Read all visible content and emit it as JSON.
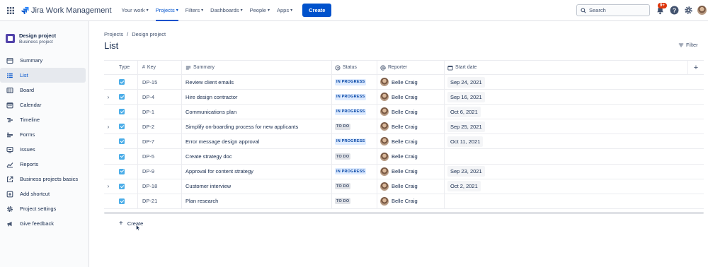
{
  "app": {
    "name": "Jira Work Management",
    "nav": [
      {
        "label": "Your work",
        "active": false
      },
      {
        "label": "Projects",
        "active": true
      },
      {
        "label": "Filters",
        "active": false
      },
      {
        "label": "Dashboards",
        "active": false
      },
      {
        "label": "People",
        "active": false
      },
      {
        "label": "Apps",
        "active": false
      }
    ],
    "create_label": "Create",
    "search_placeholder": "Search",
    "notification_badge": "9+",
    "accent": "#0052cc"
  },
  "sidebar": {
    "project_name": "Design project",
    "project_type": "Business project",
    "items": [
      {
        "label": "Summary",
        "icon": "summary-icon",
        "active": false
      },
      {
        "label": "List",
        "icon": "list-icon",
        "active": true
      },
      {
        "label": "Board",
        "icon": "board-icon",
        "active": false
      },
      {
        "label": "Calendar",
        "icon": "calendar-icon",
        "active": false
      },
      {
        "label": "Timeline",
        "icon": "timeline-icon",
        "active": false
      },
      {
        "label": "Forms",
        "icon": "forms-icon",
        "active": false
      },
      {
        "label": "Issues",
        "icon": "issues-icon",
        "active": false
      },
      {
        "label": "Reports",
        "icon": "reports-icon",
        "active": false
      },
      {
        "label": "Business projects basics",
        "icon": "external-link-icon",
        "active": false
      },
      {
        "label": "Add shortcut",
        "icon": "add-shortcut-icon",
        "active": false
      },
      {
        "label": "Project settings",
        "icon": "gear-icon",
        "active": false
      },
      {
        "label": "Give feedback",
        "icon": "megaphone-icon",
        "active": false
      }
    ]
  },
  "main": {
    "breadcrumb": [
      "Projects",
      "Design project"
    ],
    "title": "List",
    "filter_label": "Filter",
    "columns": {
      "type": "Type",
      "key": "Key",
      "summary": "Summary",
      "status": "Status",
      "reporter": "Reporter",
      "start_date": "Start date"
    },
    "rows": [
      {
        "expandable": false,
        "key": "DP-15",
        "summary": "Review client emails",
        "status": "IN PROGRESS",
        "reporter": "Belle Craig",
        "start_date": "Sep 24, 2021"
      },
      {
        "expandable": true,
        "key": "DP-4",
        "summary": "Hire design contractor",
        "status": "IN PROGRESS",
        "reporter": "Belle Craig",
        "start_date": "Sep 16, 2021"
      },
      {
        "expandable": false,
        "key": "DP-1",
        "summary": "Communications plan",
        "status": "IN PROGRESS",
        "reporter": "Belle Craig",
        "start_date": "Oct 6, 2021"
      },
      {
        "expandable": true,
        "key": "DP-2",
        "summary": "Simplify on-boarding process for new applicants",
        "status": "TO DO",
        "reporter": "Belle Craig",
        "start_date": "Sep 25, 2021"
      },
      {
        "expandable": false,
        "key": "DP-7",
        "summary": "Error message design approval",
        "status": "IN PROGRESS",
        "reporter": "Belle Craig",
        "start_date": "Oct 11, 2021"
      },
      {
        "expandable": false,
        "key": "DP-5",
        "summary": "Create strategy doc",
        "status": "TO DO",
        "reporter": "Belle Craig",
        "start_date": ""
      },
      {
        "expandable": false,
        "key": "DP-9",
        "summary": "Approval for content strategy",
        "status": "IN PROGRESS",
        "reporter": "Belle Craig",
        "start_date": "Sep 23, 2021"
      },
      {
        "expandable": true,
        "key": "DP-18",
        "summary": "Customer interview",
        "status": "TO DO",
        "reporter": "Belle Craig",
        "start_date": "Oct 2, 2021"
      },
      {
        "expandable": false,
        "key": "DP-21",
        "summary": "Plan research",
        "status": "TO DO",
        "reporter": "Belle Craig",
        "start_date": ""
      }
    ],
    "create_label": "Create"
  }
}
